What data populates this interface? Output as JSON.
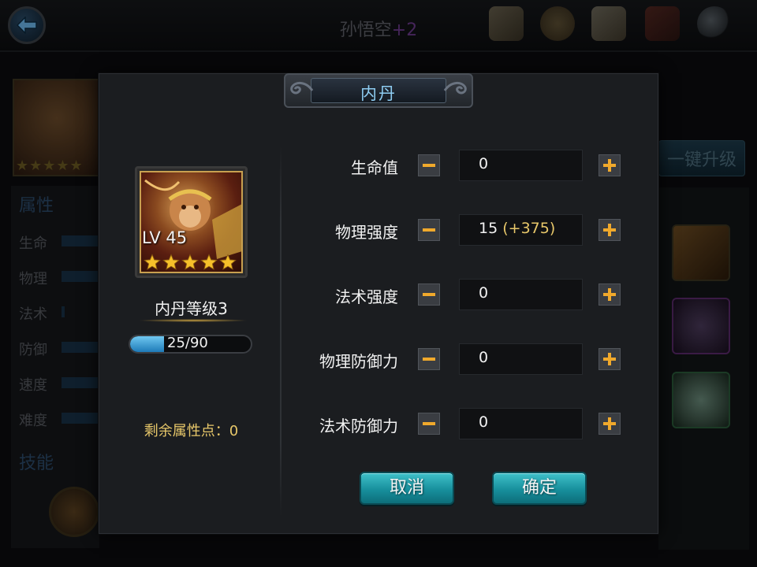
{
  "header": {
    "hero_name": "孙悟空",
    "hero_plus": "+2",
    "icons": [
      "scroll-icon",
      "medal-icon",
      "document-icon",
      "book-icon",
      "magnifier-icon"
    ]
  },
  "background": {
    "attributes_title": "属性",
    "stats": [
      "生命",
      "物理",
      "法术",
      "防御",
      "速度",
      "难度"
    ],
    "skills_title": "技能",
    "upgrade_all_label": "一键升级"
  },
  "dialog": {
    "title": "内丹",
    "hero_level": "LV 45",
    "stars": 5,
    "neidan_level": "内丹等级3",
    "progress": {
      "current": 25,
      "max": 90,
      "text": "25/90"
    },
    "remaining_points": "剩余属性点：0",
    "attributes": [
      {
        "label": "生命值",
        "value": "0",
        "bonus": ""
      },
      {
        "label": "物理强度",
        "value": "15",
        "bonus": "(+375)"
      },
      {
        "label": "法术强度",
        "value": "0",
        "bonus": ""
      },
      {
        "label": "物理防御力",
        "value": "0",
        "bonus": ""
      },
      {
        "label": "法术防御力",
        "value": "0",
        "bonus": ""
      }
    ],
    "cancel_label": "取消",
    "confirm_label": "确定"
  },
  "colors": {
    "accent_gold": "#f0a92c",
    "bonus_text": "#e8c86a",
    "title_text": "#8ecdf2",
    "button_teal": "#178f9c"
  }
}
